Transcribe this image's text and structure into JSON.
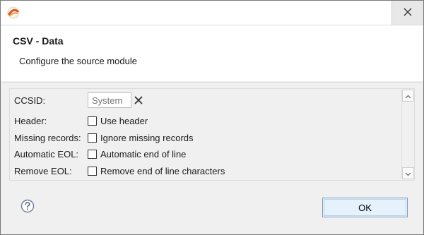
{
  "window": {
    "close_icon": "close-icon",
    "app_icon": "app-logo-icon"
  },
  "header": {
    "title": "CSV - Data",
    "description": "Configure the source module"
  },
  "form": {
    "ccsid": {
      "label": "CCSID:",
      "placeholder": "System"
    },
    "header": {
      "label": "Header:",
      "checkbox_label": "Use header",
      "checked": false
    },
    "missing": {
      "label": "Missing records:",
      "checkbox_label": "Ignore missing records",
      "checked": false
    },
    "auto_eol": {
      "label": "Automatic EOL:",
      "checkbox_label": "Automatic end of line",
      "checked": false
    },
    "remove_eol": {
      "label": "Remove EOL:",
      "checkbox_label": "Remove end of line characters",
      "checked": false
    }
  },
  "footer": {
    "ok_label": "OK",
    "help_icon": "help-icon"
  }
}
